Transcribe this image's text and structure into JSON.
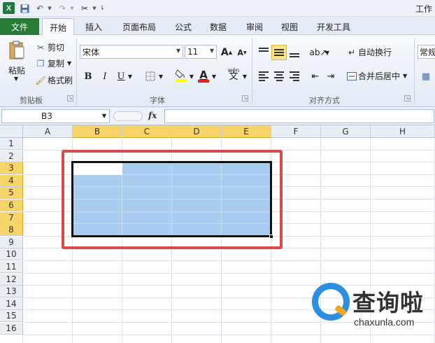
{
  "titlebar": {
    "app_icon": "X",
    "window_title": "工作"
  },
  "ribbon_tabs": {
    "file": "文件",
    "home": "开始",
    "insert": "插入",
    "page_layout": "页面布局",
    "formulas": "公式",
    "data": "数据",
    "review": "审阅",
    "view": "视图",
    "developer": "开发工具"
  },
  "clipboard": {
    "paste": "粘贴",
    "cut": "剪切",
    "copy": "复制",
    "format_painter": "格式刷",
    "group_label": "剪贴板"
  },
  "font": {
    "name": "宋体",
    "size": "11",
    "grow": "A",
    "shrink": "A",
    "bold": "B",
    "italic": "I",
    "underline": "U",
    "font_color": "A",
    "pinyin": "wén",
    "group_label": "字体"
  },
  "alignment": {
    "wrap_text": "自动换行",
    "merge_center": "合并后居中",
    "group_label": "对齐方式"
  },
  "number": {
    "format": "常规"
  },
  "formula_bar": {
    "name_box": "B3",
    "fx": "fx",
    "value": ""
  },
  "grid": {
    "columns": [
      "A",
      "B",
      "C",
      "D",
      "E",
      "F",
      "G",
      "H"
    ],
    "rows": [
      "1",
      "2",
      "3",
      "4",
      "5",
      "6",
      "7",
      "8",
      "9",
      "10",
      "11",
      "12",
      "13",
      "14",
      "15",
      "16"
    ],
    "selected_columns": [
      "B",
      "C",
      "D",
      "E"
    ],
    "selected_rows": [
      "3",
      "4",
      "5",
      "6",
      "7",
      "8"
    ]
  },
  "colors": {
    "selection": "#a9cdf0",
    "header_selected": "#f6d46a",
    "annotation": "#d94b4b",
    "file_tab": "#2a7a37"
  },
  "watermark": {
    "text": "查询啦",
    "url": "chaxunla.com"
  }
}
